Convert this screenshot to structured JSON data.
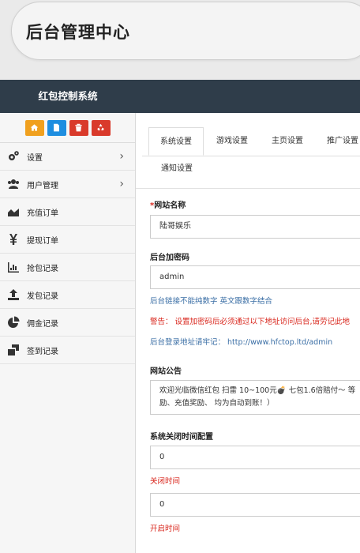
{
  "page_title": "后台管理中心",
  "brand": "红包控制系统",
  "colors": {
    "header_bg": "#2f3d4a",
    "shortcut_orange": "#f0a01e",
    "shortcut_blue": "#1e8ee0",
    "shortcut_red1": "#d93a2b",
    "shortcut_red2": "#d93a2b",
    "required": "#d9261c",
    "link_blue": "#3a6ea5"
  },
  "shortcuts": [
    {
      "icon": "home-icon"
    },
    {
      "icon": "file-icon"
    },
    {
      "icon": "trash-icon"
    },
    {
      "icon": "recycle-icon"
    }
  ],
  "sidebar": {
    "items": [
      {
        "label": "设置",
        "icon": "gears-icon",
        "has_chevron": true,
        "chevron": "›"
      },
      {
        "label": "用户管理",
        "icon": "users-icon",
        "has_chevron": true,
        "chevron": "›"
      },
      {
        "label": "充值订单",
        "icon": "area-chart-icon"
      },
      {
        "label": "提现订单",
        "icon": "yen-icon"
      },
      {
        "label": "抢包记录",
        "icon": "bar-chart-icon"
      },
      {
        "label": "发包记录",
        "icon": "upload-icon"
      },
      {
        "label": "佣金记录",
        "icon": "pie-chart-icon"
      },
      {
        "label": "签到记录",
        "icon": "windows-icon"
      }
    ]
  },
  "tabs": [
    {
      "label": "系统设置",
      "active": true
    },
    {
      "label": "游戏设置"
    },
    {
      "label": "主页设置"
    },
    {
      "label": "推广设置"
    },
    {
      "label": "通知设置"
    }
  ],
  "form": {
    "site_name": {
      "required_mark": "*",
      "label": "网站名称",
      "value": "陆哥娱乐"
    },
    "admin_pwd": {
      "label": "后台加密码",
      "value": "admin"
    },
    "pwd_hint": "后台链接不能纯数字 英文跟数字结合",
    "warning": "警告： 设置加密码后必须通过以下地址访问后台,请劳记此地",
    "login_url": "后台登录地址请牢记： http://www.hfctop.ltd/admin",
    "notice": {
      "label": "网站公告",
      "line1": "欢迎光临微信红包 扫雷 10~100元💣 七包1.6倍赔付～ 等",
      "line2": "励、充值奖励、 均为自动到账！）"
    },
    "close_time_config": {
      "label": "系统关闭时间配置"
    },
    "close_time": {
      "value": "0",
      "hint": "关闭时间"
    },
    "open_time": {
      "value": "0",
      "hint": "开启时间"
    }
  }
}
